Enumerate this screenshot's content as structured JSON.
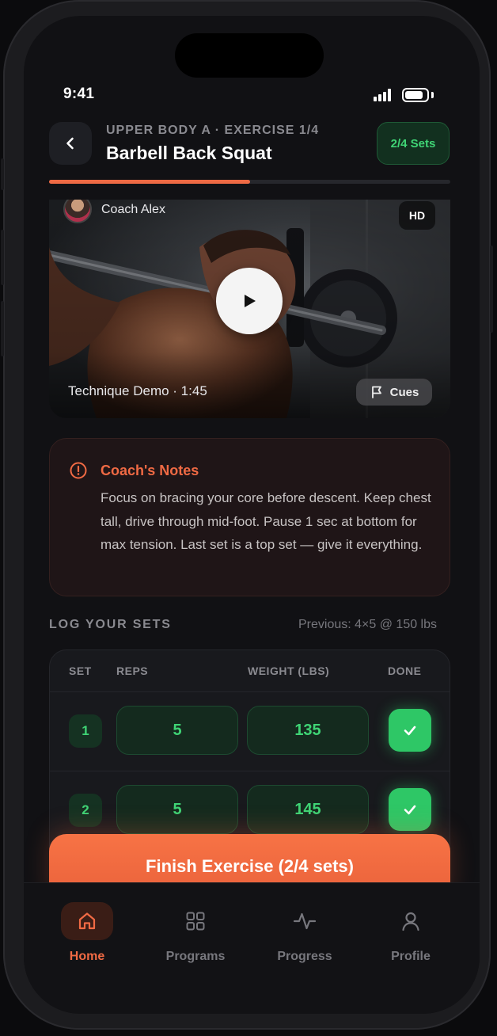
{
  "status_bar": {
    "time": "9:41"
  },
  "header": {
    "subtitle": "UPPER BODY A · EXERCISE 1/4",
    "title": "Barbell Back Squat",
    "sets_badge": "2/4 Sets",
    "progress_fraction": 0.5
  },
  "video": {
    "coach_name": "Coach Alex",
    "quality_badge": "HD",
    "caption": "Technique Demo · 1:45",
    "cues_label": "Cues"
  },
  "notes": {
    "title": "Coach's Notes",
    "body": "Focus on bracing your core before descent. Keep chest tall, drive through mid-foot. Pause 1 sec at bottom for max tension. Last set is a top set — give it everything."
  },
  "log": {
    "title": "LOG YOUR SETS",
    "previous": "Previous: 4×5 @ 150 lbs",
    "columns": {
      "set": "SET",
      "reps": "REPS",
      "weight": "WEIGHT (LBS)",
      "done": "DONE"
    },
    "rows": [
      {
        "set": "1",
        "reps": "5",
        "weight": "135",
        "done": true
      },
      {
        "set": "2",
        "reps": "5",
        "weight": "145",
        "done": true
      }
    ]
  },
  "finish_button": "Finish Exercise (2/4 sets)",
  "tabs": [
    {
      "label": "Home",
      "icon": "home-icon",
      "active": true
    },
    {
      "label": "Programs",
      "icon": "grid-icon",
      "active": false
    },
    {
      "label": "Progress",
      "icon": "activity-icon",
      "active": false
    },
    {
      "label": "Profile",
      "icon": "user-icon",
      "active": false
    }
  ],
  "colors": {
    "accent": "#ee6a44",
    "success": "#3fd475",
    "background": "#111114"
  }
}
